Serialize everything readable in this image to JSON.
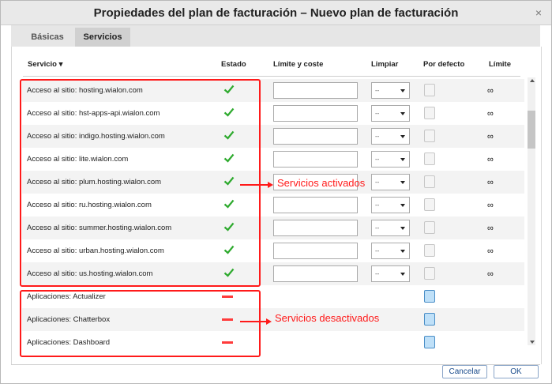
{
  "window": {
    "title": "Propiedades del plan de facturación – Nuevo plan de facturación",
    "close_glyph": "×"
  },
  "tabs": [
    {
      "label": "Básicas",
      "active": false
    },
    {
      "label": "Servicios",
      "active": true
    }
  ],
  "columns": {
    "servicio": "Servicio ▾",
    "estado": "Estado",
    "limite_coste": "Límite y coste",
    "limpiar": "Limpiar",
    "por_defecto": "Por defecto",
    "limite": "Límite"
  },
  "rows": [
    {
      "service": "Acceso al sitio: hosting.wialon.com",
      "status": "enabled",
      "select": "--",
      "limit": "∞"
    },
    {
      "service": "Acceso al sitio: hst-apps-api.wialon.com",
      "status": "enabled",
      "select": "--",
      "limit": "∞"
    },
    {
      "service": "Acceso al sitio: indigo.hosting.wialon.com",
      "status": "enabled",
      "select": "--",
      "limit": "∞"
    },
    {
      "service": "Acceso al sitio: lite.wialon.com",
      "status": "enabled",
      "select": "--",
      "limit": "∞"
    },
    {
      "service": "Acceso al sitio: plum.hosting.wialon.com",
      "status": "enabled",
      "select": "--",
      "limit": "∞"
    },
    {
      "service": "Acceso al sitio: ru.hosting.wialon.com",
      "status": "enabled",
      "select": "--",
      "limit": "∞"
    },
    {
      "service": "Acceso al sitio: summer.hosting.wialon.com",
      "status": "enabled",
      "select": "--",
      "limit": "∞"
    },
    {
      "service": "Acceso al sitio: urban.hosting.wialon.com",
      "status": "enabled",
      "select": "--",
      "limit": "∞"
    },
    {
      "service": "Acceso al sitio: us.hosting.wialon.com",
      "status": "enabled",
      "select": "--",
      "limit": "∞"
    },
    {
      "service": "Aplicaciones: Actualizer",
      "status": "disabled"
    },
    {
      "service": "Aplicaciones: Chatterbox",
      "status": "disabled"
    },
    {
      "service": "Aplicaciones: Dashboard",
      "status": "disabled"
    }
  ],
  "annotations": {
    "activated": "Servicios activados",
    "deactivated": "Servicios desactivados"
  },
  "buttons": {
    "cancel": "Cancelar",
    "ok": "OK"
  },
  "colors": {
    "check_green": "#2eaa2e",
    "minus_red": "#ff3b3b",
    "annotation_red": "#ff1a1a"
  },
  "icons": {
    "enabled": "check-icon",
    "disabled": "minus-icon",
    "default": "document-icon"
  }
}
